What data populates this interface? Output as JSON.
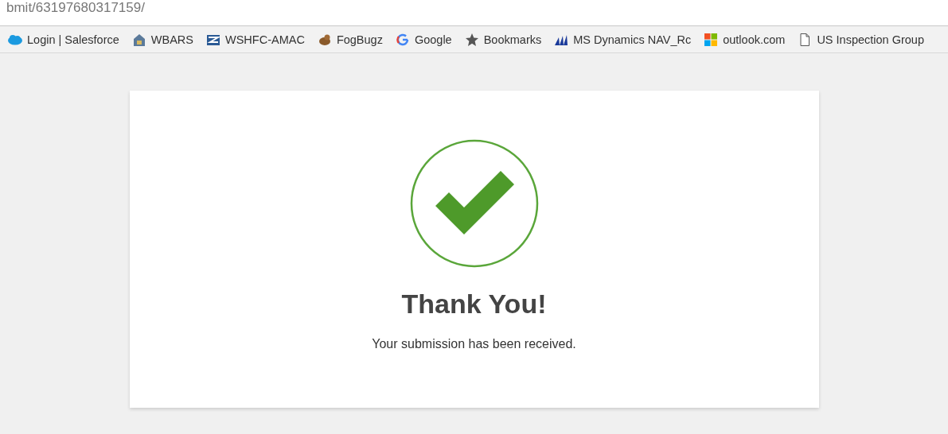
{
  "address_bar": {
    "url": "bmit/63197680317159/"
  },
  "bookmarks": [
    {
      "label": "Login | Salesforce",
      "kind": "cloud"
    },
    {
      "label": "WBARS",
      "kind": "house"
    },
    {
      "label": "WSHFC-AMAC",
      "kind": "logo"
    },
    {
      "label": "FogBugz",
      "kind": "animal"
    },
    {
      "label": "Google",
      "kind": "g"
    },
    {
      "label": "Bookmarks",
      "kind": "star"
    },
    {
      "label": "MS Dynamics NAV_Rc",
      "kind": "peaks"
    },
    {
      "label": "outlook.com",
      "kind": "windows"
    },
    {
      "label": "US Inspection Group",
      "kind": "page"
    }
  ],
  "card": {
    "title": "Thank You!",
    "message": "Your submission has been received."
  }
}
